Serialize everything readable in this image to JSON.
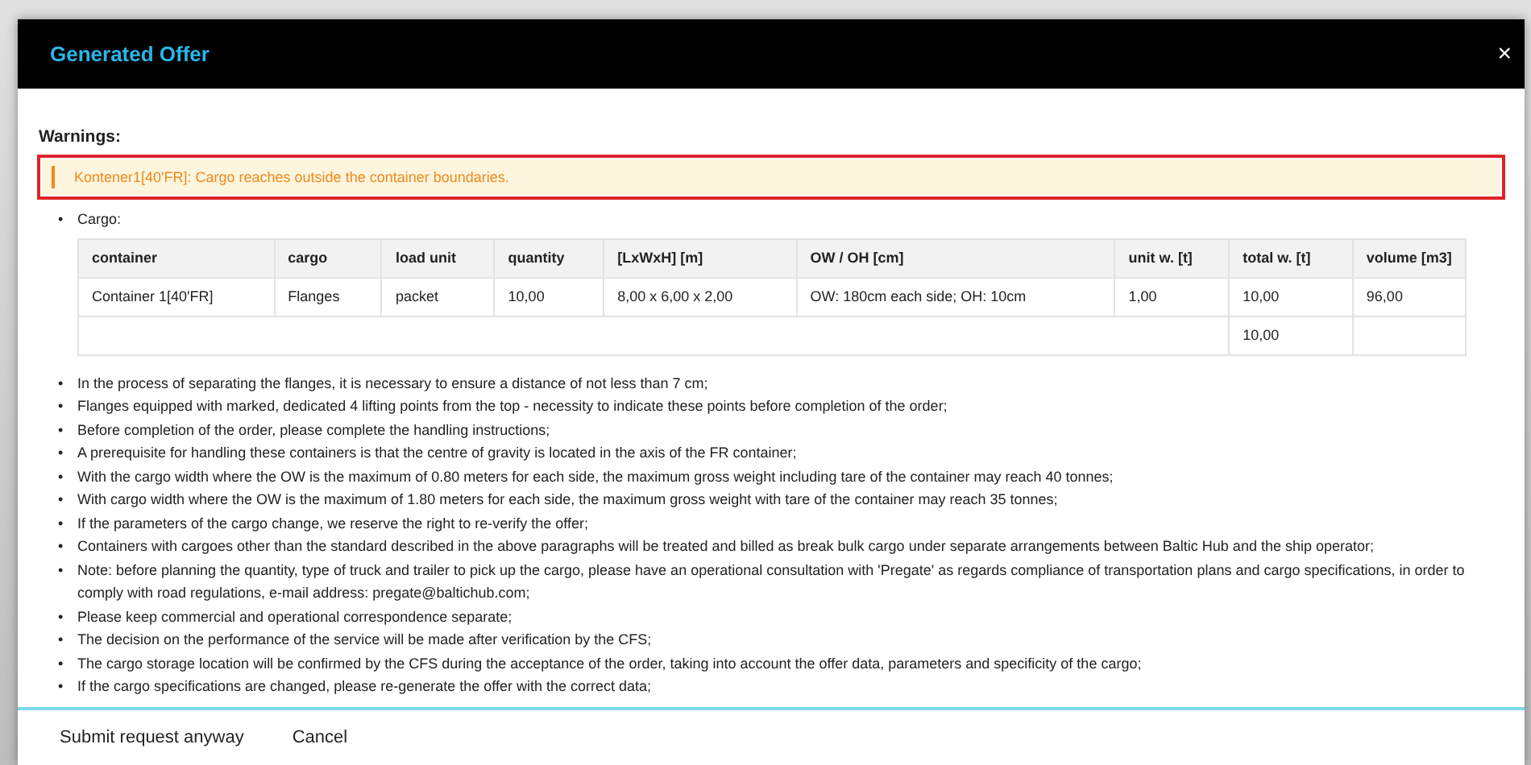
{
  "dialog": {
    "title": "Generated Offer",
    "close": "×"
  },
  "warnings": {
    "heading": "Warnings:",
    "items": [
      "Kontener1[40'FR]: Cargo reaches outside the container boundaries."
    ]
  },
  "cargo": {
    "label": "Cargo:",
    "columns": [
      "container",
      "cargo",
      "load unit",
      "quantity",
      "[LxWxH] [m]",
      "OW / OH [cm]",
      "unit w. [t]",
      "total w. [t]",
      "volume [m3]"
    ],
    "rows": [
      [
        "Container 1[40'FR]",
        "Flanges",
        "packet",
        "10,00",
        "8,00 x 6,00 x 2,00",
        "OW: 180cm each side; OH: 10cm",
        "1,00",
        "10,00",
        "96,00"
      ]
    ],
    "total": "10,00"
  },
  "notes": [
    "In the process of separating the flanges, it is necessary to ensure a distance of not less than 7 cm;",
    "Flanges equipped with marked, dedicated 4 lifting points from the top - necessity to indicate these points before completion of the order;",
    "Before completion of the order, please complete the handling instructions;",
    "A prerequisite for handling these containers is that the centre of gravity is located in the axis of the FR container;",
    "With the cargo width where the OW is the maximum of 0.80 meters for each side, the maximum gross weight including tare of the container may reach 40 tonnes;",
    "With cargo width where the OW is the maximum of 1.80 meters for each side, the maximum gross weight with tare of the container may reach 35 tonnes;",
    "If the parameters of the cargo change, we reserve the right to re-verify the offer;",
    "Containers with cargoes other than the standard described in the above paragraphs will be treated and billed as break bulk cargo under separate arrangements between Baltic Hub and the ship operator;",
    "Note: before planning the quantity, type of truck and trailer to pick up the cargo, please have an operational consultation with 'Pregate' as regards compliance of transportation plans and cargo specifications, in order to comply with road regulations, e-mail address: pregate@baltichub.com;",
    "Please keep commercial and operational correspondence separate;",
    "The decision on the performance of the service will be made after verification by the CFS;",
    "The cargo storage location will be confirmed by the CFS during the acceptance of the order, taking into account the offer data, parameters and specificity of the cargo;",
    "If the cargo specifications are changed, please re-generate the offer with the correct data;"
  ],
  "bullet": "•",
  "buttons": [
    "Submit request anyway",
    "Cancel"
  ]
}
